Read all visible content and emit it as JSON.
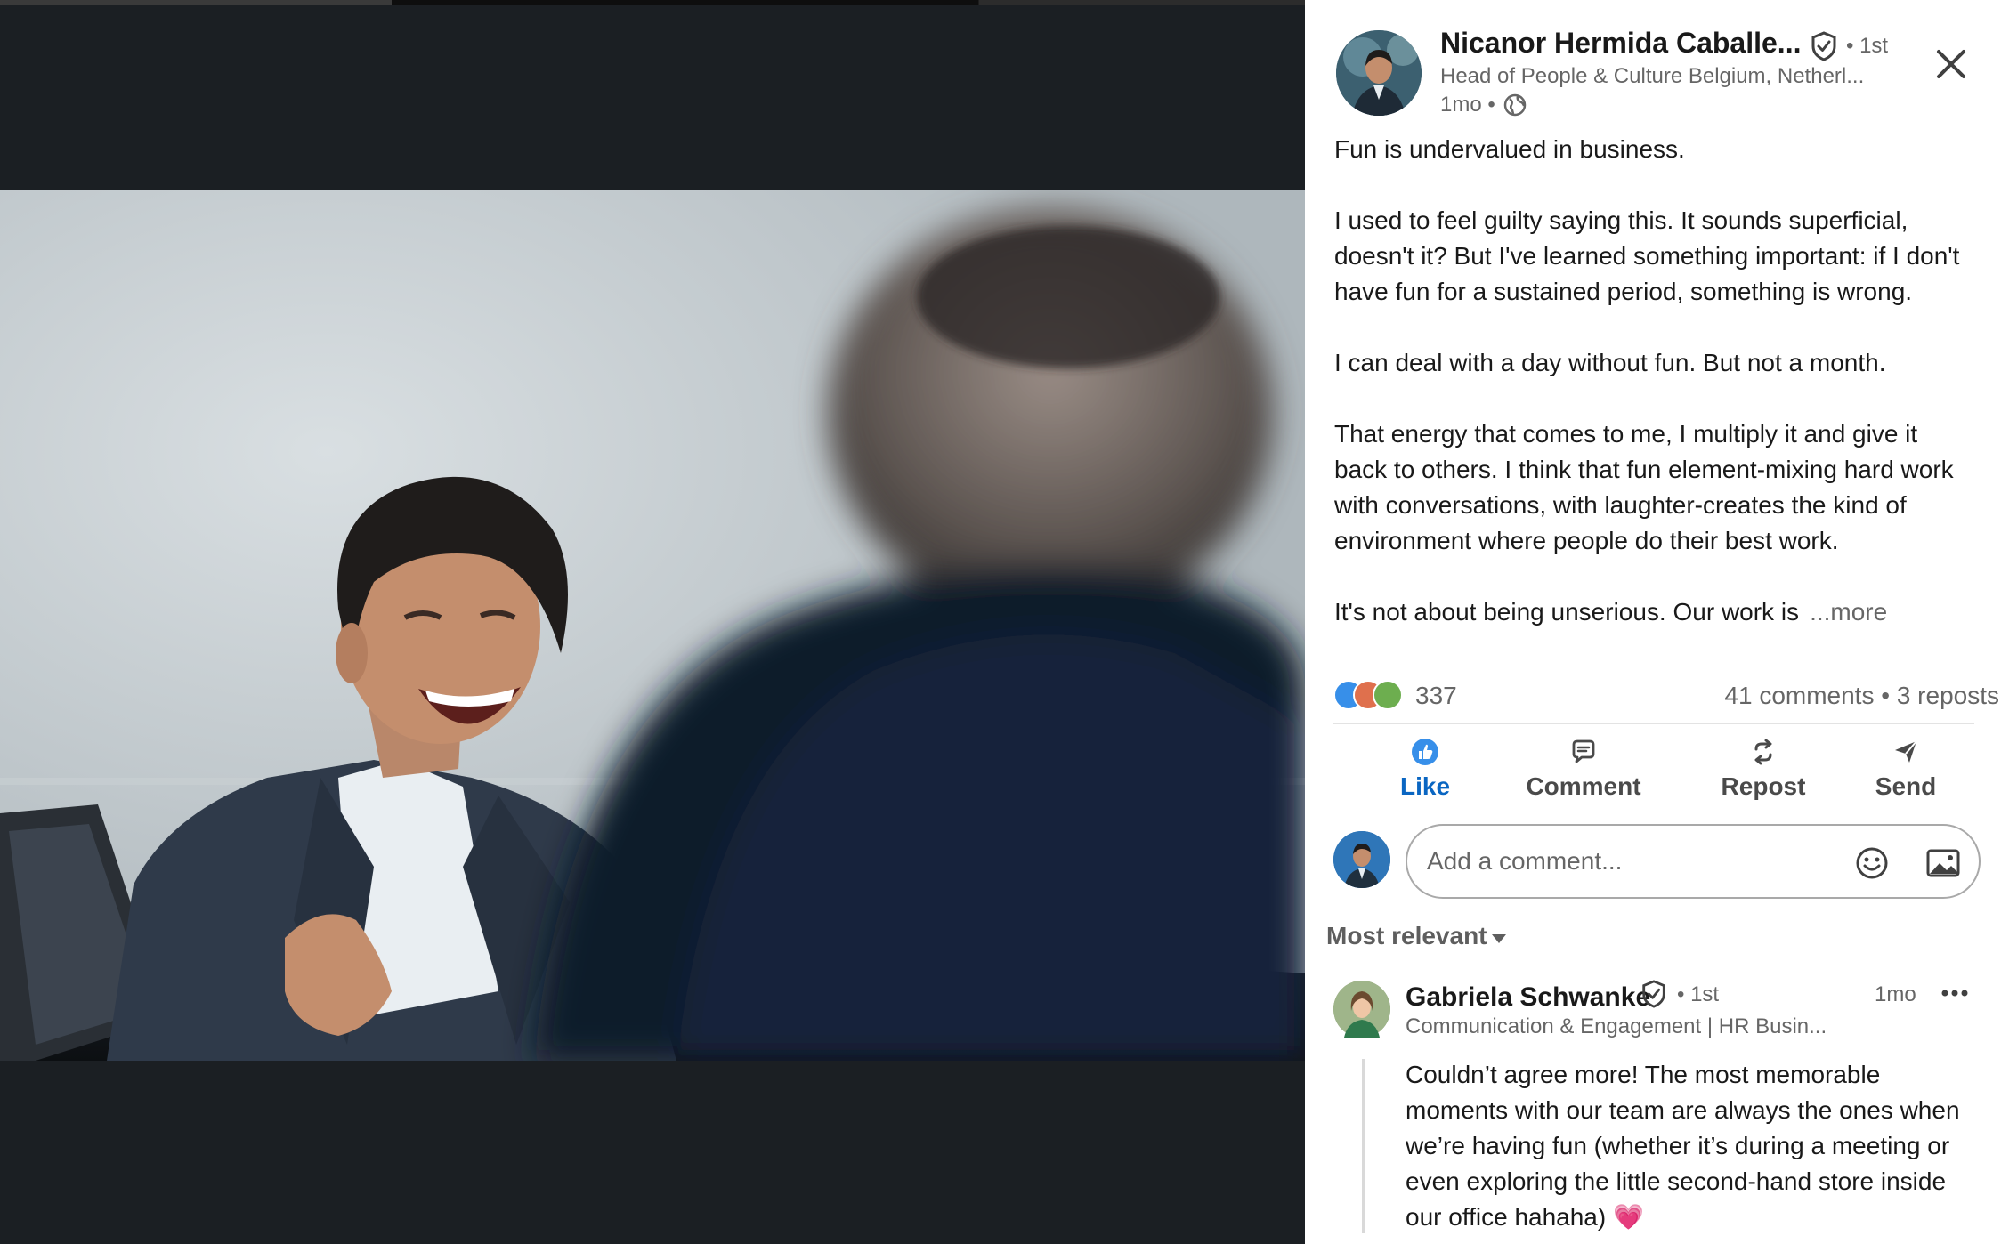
{
  "author": {
    "name": "Nicanor Hermida Caballe...",
    "degree": "• 1st",
    "headline": "Head of People & Culture Belgium, Netherl...",
    "time": "1mo •"
  },
  "post": {
    "paragraphs": [
      "Fun is undervalued in business.",
      "I used to feel guilty saying this. It sounds superficial, doesn't it? But I've learned something important: if I don't have fun for a sustained period, something is wrong.",
      "I can deal with a day without fun. But not a month.",
      "That energy that comes to me, I multiply it and give it back to others. I think that fun element-mixing hard work with conversations, with laughter-creates the kind of environment where people do their best work."
    ],
    "last_line": "It's not about being unserious. Our work is",
    "more_label": "...more"
  },
  "social": {
    "reaction_count": "337",
    "comments_reposts": "41 comments • 3 reposts"
  },
  "actions": {
    "like": "Like",
    "comment": "Comment",
    "repost": "Repost",
    "send": "Send"
  },
  "comment_input": {
    "placeholder": "Add a comment..."
  },
  "sort": {
    "label": "Most relevant"
  },
  "comments": [
    {
      "name": "Gabriela Schwanke",
      "degree": "• 1st",
      "headline": "Communication & Engagement | HR Busin...",
      "time": "1mo",
      "text": "Couldn’t agree more! The most memorable moments with our team are always the ones when we’re having fun (whether it’s during a meeting or even exploring the little second-hand store inside our office hahaha) 💗"
    }
  ],
  "colors": {
    "accent": "#0a66c2",
    "media_background": "#1b1f23",
    "panel_background": "#ffffff"
  }
}
